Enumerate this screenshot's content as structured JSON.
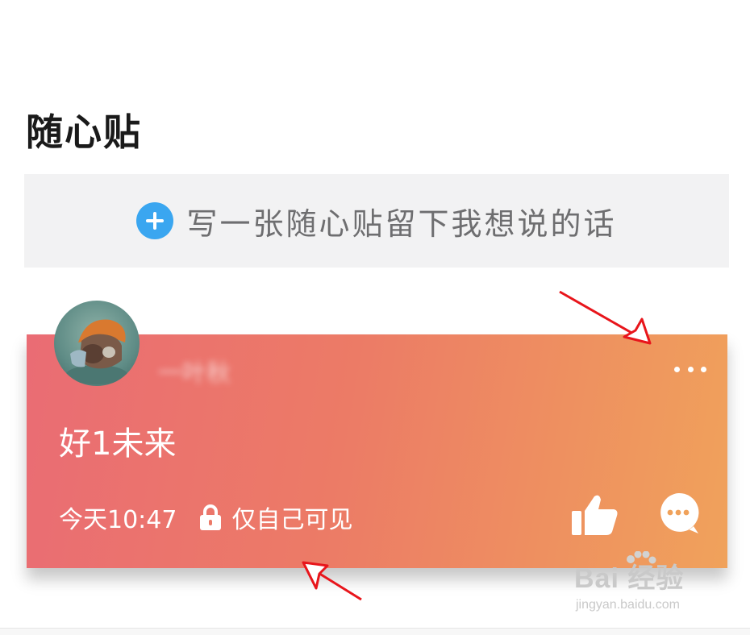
{
  "page": {
    "title": "随心贴"
  },
  "compose": {
    "placeholder": "写一张随心贴留下我想说的话",
    "icon": "plus-circle-icon",
    "accent": "#3aa6f0"
  },
  "post": {
    "author": "一叶秋",
    "content": "好1未来",
    "time": "今天10:47",
    "visibility": "仅自己可见",
    "gradient": [
      "#ea6c74",
      "#f0a25b"
    ],
    "icons": {
      "more": "more-dots-icon",
      "like": "thumbs-up-icon",
      "comment": "comment-bubble-icon",
      "lock": "lock-icon"
    }
  },
  "annotations": {
    "arrow_color": "#e8151b"
  },
  "watermark": {
    "brand": "Bai 经验",
    "url": "jingyan.baidu.com"
  }
}
